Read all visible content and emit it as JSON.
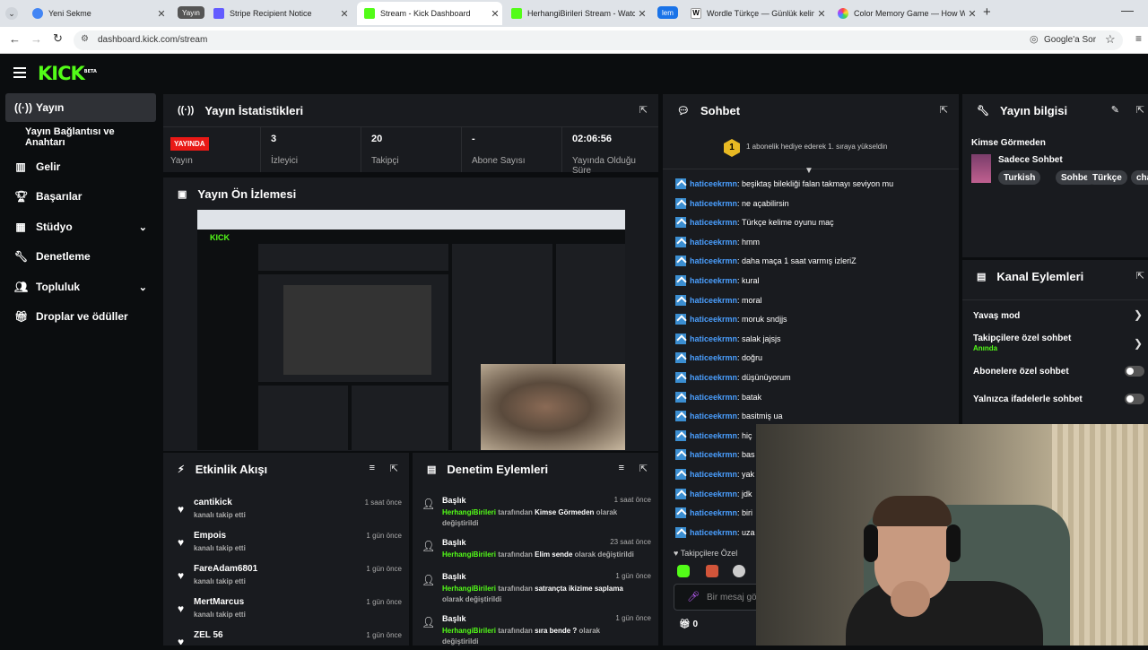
{
  "browser": {
    "tabs": [
      {
        "label": "Yeni Sekme",
        "color": "#4285f4"
      },
      {
        "label": "Stripe Recipient Notice",
        "color": "#635bff"
      },
      {
        "label": "Stream - Kick Dashboard",
        "color": "#53fc18"
      },
      {
        "label": "HerhangiBirileri Stream - Watch",
        "color": "#53fc18"
      },
      {
        "label": "Wordle Türkçe — Günlük kelim",
        "color": "#ffffff"
      },
      {
        "label": "Color Memory Game — How W",
        "color": "#ff6b6b"
      }
    ],
    "group_yayin": "Yayın",
    "group_lem": "lem",
    "url": "dashboard.kick.com/stream",
    "google_sor": "Google'a Sor"
  },
  "app": {
    "logo": "KICK",
    "logo_beta": "BETA",
    "accent": "#53fc18"
  },
  "sidebar": {
    "items": [
      {
        "label": "Yayın",
        "icon": "broadcast-icon"
      },
      {
        "label": "Yayın Bağlantısı ve Anahtarı",
        "icon": ""
      },
      {
        "label": "Gelir",
        "icon": "bar-chart-icon"
      },
      {
        "label": "Başarılar",
        "icon": "trophy-icon"
      },
      {
        "label": "Stüdyo",
        "icon": "studio-icon"
      },
      {
        "label": "Denetleme",
        "icon": "wrench-icon"
      },
      {
        "label": "Topluluk",
        "icon": "people-icon"
      },
      {
        "label": "Droplar ve ödüller",
        "icon": "gift-icon"
      }
    ]
  },
  "stats": {
    "title": "Yayın İstatistikleri",
    "live_badge": "YAYINDA",
    "items": [
      {
        "value": "",
        "label": "Yayın"
      },
      {
        "value": "3",
        "label": "İzleyici"
      },
      {
        "value": "20",
        "label": "Takipçi"
      },
      {
        "value": "-",
        "label": "Abone Sayısı"
      },
      {
        "value": "02:06:56",
        "label": "Yayında Olduğu Süre"
      }
    ]
  },
  "preview": {
    "title": "Yayın Ön İzlemesi"
  },
  "events": {
    "title": "Etkinlik Akışı",
    "items": [
      {
        "name": "cantikick",
        "sub": "kanalı takip etti",
        "time": "1 saat önce"
      },
      {
        "name": "Empois",
        "sub": "kanalı takip etti",
        "time": "1 gün önce"
      },
      {
        "name": "FareAdam6801",
        "sub": "kanalı takip etti",
        "time": "1 gün önce"
      },
      {
        "name": "MertMarcus",
        "sub": "kanalı takip etti",
        "time": "1 gün önce"
      },
      {
        "name": "ZEL 56",
        "sub": "",
        "time": "1 gün önce"
      }
    ]
  },
  "moderation": {
    "title": "Denetim Eylemleri",
    "items": [
      {
        "head": "Başlık",
        "time": "1 saat önce",
        "user": "HerhangiBirileri",
        "mid": "tarafından",
        "value": "Kimse Görmeden",
        "tail": "olarak değiştirildi"
      },
      {
        "head": "Başlık",
        "time": "23 saat önce",
        "user": "HerhangiBirileri",
        "mid": "tarafından",
        "value": "Elim sende",
        "tail": "olarak değiştirildi"
      },
      {
        "head": "Başlık",
        "time": "1 gün önce",
        "user": "HerhangiBirileri",
        "mid": "tarafından",
        "value": "satrançta ikizime saplama",
        "tail": "olarak değiştirildi"
      },
      {
        "head": "Başlık",
        "time": "1 gün önce",
        "user": "HerhangiBirileri",
        "mid": "tarafından",
        "value": "sıra bende ?",
        "tail": "olarak değiştirildi"
      }
    ]
  },
  "chat": {
    "title": "Sohbet",
    "pinned": "1 abonelik hediye ederek 1. sıraya yükseldin",
    "badge_number": "1",
    "messages": [
      {
        "user": "haticeekrmn",
        "text": "beşiktaş bilekliği falan takmayı seviyon mu"
      },
      {
        "user": "haticeekrmn",
        "text": "ne açabilirsin"
      },
      {
        "user": "haticeekrmn",
        "text": "Türkçe kelime oyunu maç"
      },
      {
        "user": "haticeekrmn",
        "text": "hmm"
      },
      {
        "user": "haticeekrmn",
        "text": "daha maça 1 saat varmış izleriZ"
      },
      {
        "user": "haticeekrmn",
        "text": "kural"
      },
      {
        "user": "haticeekrmn",
        "text": "moral"
      },
      {
        "user": "haticeekrmn",
        "text": "moruk sndjjs"
      },
      {
        "user": "haticeekrmn",
        "text": "salak jajsjs"
      },
      {
        "user": "haticeekrmn",
        "text": "doğru"
      },
      {
        "user": "haticeekrmn",
        "text": "düşünüyorum"
      },
      {
        "user": "haticeekrmn",
        "text": "batak"
      },
      {
        "user": "haticeekrmn",
        "text": "basitmiş ua"
      },
      {
        "user": "haticeekrmn",
        "text": "hiç"
      },
      {
        "user": "haticeekrmn",
        "text": "bas"
      },
      {
        "user": "haticeekrmn",
        "text": "yak"
      },
      {
        "user": "haticeekrmn",
        "text": "jdk"
      },
      {
        "user": "haticeekrmn",
        "text": "biri"
      },
      {
        "user": "haticeekrmn",
        "text": "uza"
      }
    ],
    "followers_only": "Takipçilere Özel",
    "input_placeholder": "Bir mesaj gö",
    "count": "0"
  },
  "info": {
    "title": "Yayın bilgisi",
    "stream_title": "Kimse Görmeden",
    "category": "Sadece Sohbet",
    "tags": [
      "Turkish",
      "Sohbet",
      "Türkçe",
      "cha"
    ]
  },
  "channel_actions": {
    "title": "Kanal Eylemleri",
    "items": [
      {
        "label": "Yavaş mod",
        "control": "chevron",
        "sub": ""
      },
      {
        "label": "Takipçilere özel sohbet",
        "control": "chevron",
        "sub": "Anında"
      },
      {
        "label": "Abonelere özel sohbet",
        "control": "toggle",
        "sub": ""
      },
      {
        "label": "Yalnızca ifadelerle sohbet",
        "control": "toggle",
        "sub": ""
      }
    ]
  }
}
